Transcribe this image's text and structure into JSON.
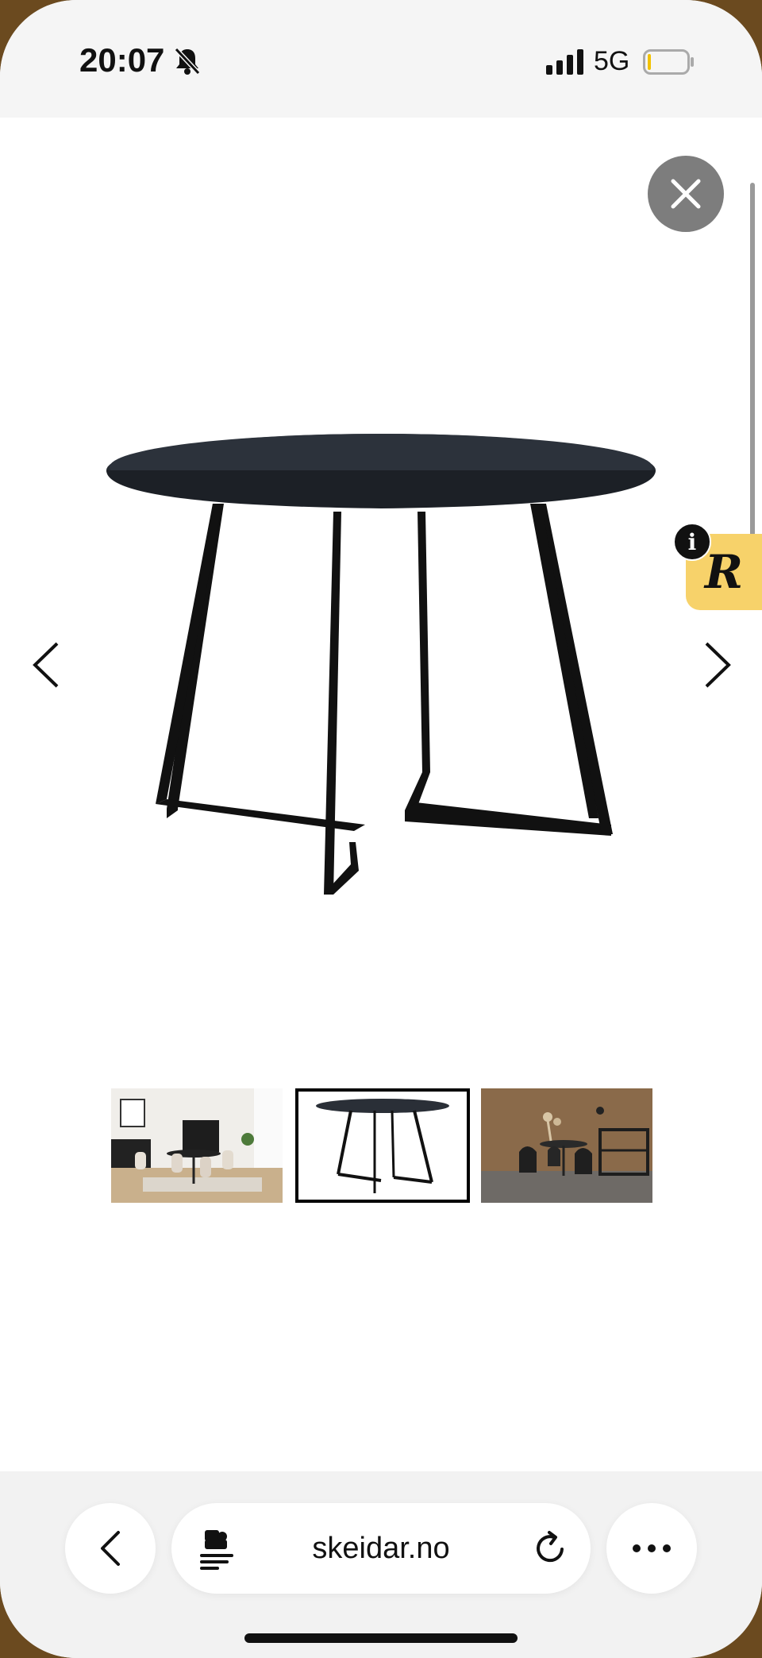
{
  "status_bar": {
    "time": "20:07",
    "network": "5G",
    "icons": [
      "bell-slash-icon",
      "cellular-signal-icon",
      "battery-icon"
    ]
  },
  "gallery": {
    "close_icon": "close-icon",
    "prev_icon": "chevron-left-icon",
    "next_icon": "chevron-right-icon",
    "main_image": "round black dining table",
    "thumbnails": [
      {
        "name": "room-scene-light",
        "selected": false
      },
      {
        "name": "table-product",
        "selected": true
      },
      {
        "name": "room-scene-dark",
        "selected": false
      }
    ]
  },
  "widget": {
    "logo_letter": "R",
    "info_label": "i"
  },
  "browser": {
    "url": "skeidar.no",
    "back_icon": "chevron-left-icon",
    "reader_icon": "page-extension-icon",
    "reload_icon": "reload-icon",
    "more_icon": "more-icon"
  },
  "colors": {
    "close_bg": "#7d7d7d",
    "widget_bg": "#f7d26a",
    "table": "#262b33",
    "toolbar_bg": "#f2f2f2"
  }
}
